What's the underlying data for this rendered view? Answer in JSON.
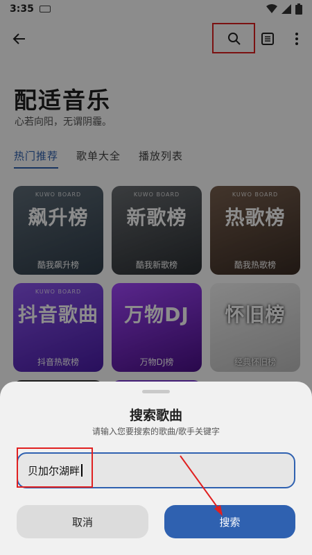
{
  "status": {
    "time": "3:35"
  },
  "header": {
    "title": "配适音乐",
    "subtitle": "心若向阳，无谓阴霾。"
  },
  "tabs": [
    {
      "label": "热门推荐",
      "active": true
    },
    {
      "label": "歌单大全",
      "active": false
    },
    {
      "label": "播放列表",
      "active": false
    }
  ],
  "cards": [
    {
      "art_text": "飙升榜",
      "label": "酷我飙升榜"
    },
    {
      "art_text": "新歌榜",
      "label": "酷我新歌榜"
    },
    {
      "art_text": "热歌榜",
      "label": "酷我热歌榜"
    },
    {
      "art_text": "抖音歌曲",
      "label": "抖音热歌榜"
    },
    {
      "art_text": "万物DJ",
      "label": "万物DJ榜"
    },
    {
      "art_text": "怀旧榜",
      "label": "经典怀旧榜"
    }
  ],
  "card_brand": "KUWO BOARD",
  "dialog": {
    "title": "搜索歌曲",
    "hint": "请输入您要搜索的歌曲/歌手关键字",
    "input_value": "贝加尔湖畔",
    "cancel_label": "取消",
    "confirm_label": "搜索"
  },
  "colors": {
    "accent": "#2f61b0",
    "highlight": "#e02020"
  }
}
